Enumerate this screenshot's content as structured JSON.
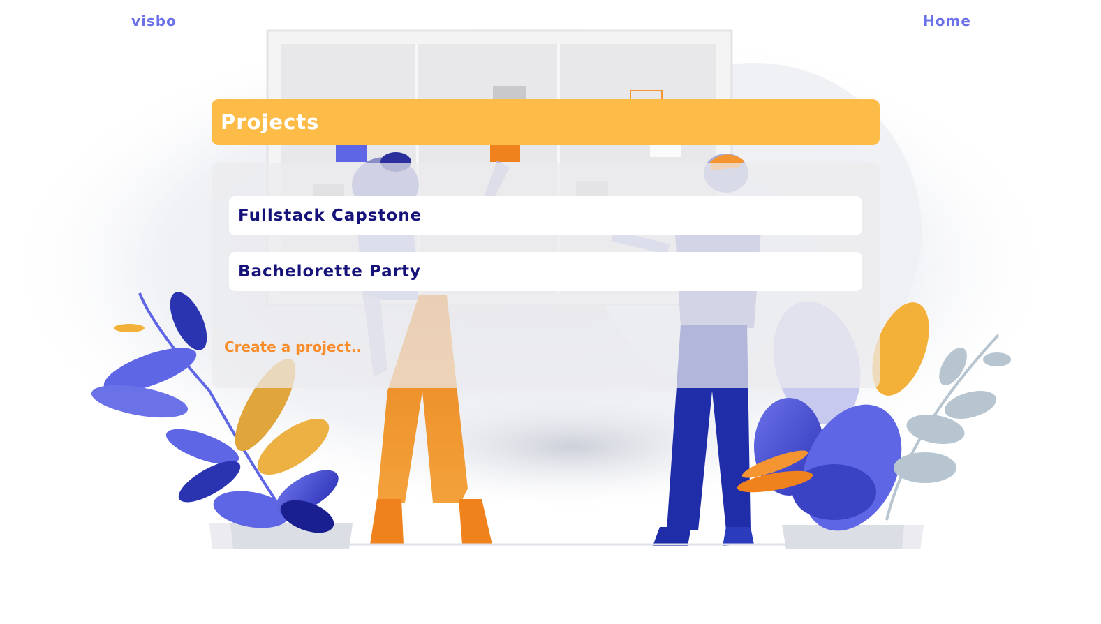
{
  "nav": {
    "brand": "visbo",
    "home_label": "Home"
  },
  "header": {
    "title": "Projects"
  },
  "projects": [
    {
      "name": "Fullstack Capstone"
    },
    {
      "name": "Bachelorette Party"
    }
  ],
  "actions": {
    "create_label": "Create a project.."
  },
  "colors": {
    "accent": "#6b72e8",
    "header_bg": "#fdbb48",
    "project_text": "#15127a",
    "create_link": "#f98d2b"
  },
  "illustration": {
    "subject": "background-illustration-people-at-whiteboard"
  }
}
